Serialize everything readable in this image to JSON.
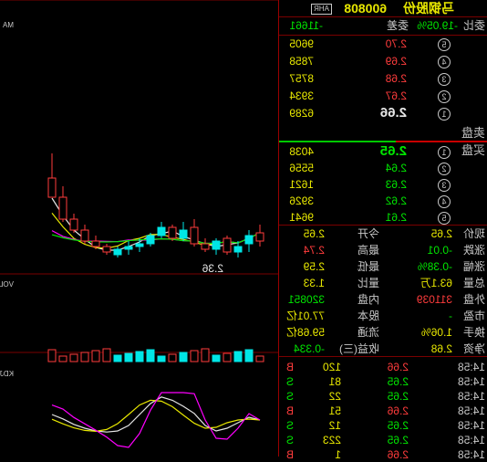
{
  "header": {
    "code": "600808",
    "name": "马钢股份",
    "badge": "AHR"
  },
  "weibi": {
    "label": "委比",
    "pct": "-19.05%",
    "label2": "委差",
    "diff": "-11661"
  },
  "sell_label": "卖盘",
  "buy_label": "买盘",
  "sells": [
    {
      "n": "5",
      "price": "2.70",
      "vol": "9605"
    },
    {
      "n": "4",
      "price": "2.69",
      "vol": "7858"
    },
    {
      "n": "3",
      "price": "2.68",
      "vol": "8757"
    },
    {
      "n": "2",
      "price": "2.67",
      "vol": "3934"
    },
    {
      "n": "1",
      "price": "2.66",
      "vol": "6289"
    }
  ],
  "buys": [
    {
      "n": "1",
      "price": "2.65",
      "vol": "4038"
    },
    {
      "n": "2",
      "price": "2.64",
      "vol": "5556"
    },
    {
      "n": "3",
      "price": "2.63",
      "vol": "1621"
    },
    {
      "n": "4",
      "price": "2.62",
      "vol": "3926"
    },
    {
      "n": "5",
      "price": "2.61",
      "vol": "9641"
    }
  ],
  "stats": [
    {
      "l1": "现价",
      "v1": "2.65",
      "l2": "今开",
      "v2": "2.65"
    },
    {
      "l1": "涨跌",
      "v1": "-0.01",
      "l2": "最高",
      "v2": "2.74"
    },
    {
      "l1": "涨幅",
      "v1": "-0.38%",
      "l2": "最低",
      "v2": "2.59"
    },
    {
      "l1": "总量",
      "v1": "63.1万",
      "l2": "量比",
      "v2": "1.33"
    },
    {
      "l1": "外盘",
      "v1": "311039",
      "l2": "内盘",
      "v2": "320851"
    },
    {
      "l1": "市盈",
      "v1": "-",
      "l2": "股本",
      "v2": "77.01亿"
    },
    {
      "l1": "换手",
      "v1": "1.06%",
      "l2": "流通",
      "v2": "59.68亿"
    },
    {
      "l1": "净资",
      "v1": "2.68",
      "l2": "收益(三)",
      "v2": "-0.334"
    }
  ],
  "ticks": [
    {
      "t": "14:58",
      "p": "2.66",
      "v": "120",
      "s": "B"
    },
    {
      "t": "14:58",
      "p": "2.65",
      "v": "81",
      "s": "S"
    },
    {
      "t": "14:58",
      "p": "2.65",
      "v": "22",
      "s": "S"
    },
    {
      "t": "14:58",
      "p": "2.66",
      "v": "51",
      "s": "B"
    },
    {
      "t": "14:58",
      "p": "2.65",
      "v": "12",
      "s": "S"
    },
    {
      "t": "14:58",
      "p": "2.65",
      "v": "223",
      "s": "S"
    },
    {
      "t": "14:58",
      "p": "2.66",
      "v": "1",
      "s": "B"
    }
  ],
  "chart": {
    "low_label": "2.36",
    "vol_label": "VOL",
    "ind_label": "KDJ",
    "ma_label": "MA"
  },
  "chart_data": {
    "type": "candlestick",
    "low": 2.36,
    "candles": [
      {
        "o": 2.42,
        "c": 2.45,
        "h": 2.48,
        "l": 2.4
      },
      {
        "o": 2.44,
        "c": 2.41,
        "h": 2.46,
        "l": 2.38
      },
      {
        "o": 2.4,
        "c": 2.38,
        "h": 2.42,
        "l": 2.36
      },
      {
        "o": 2.38,
        "c": 2.43,
        "h": 2.44,
        "l": 2.37
      },
      {
        "o": 2.42,
        "c": 2.39,
        "h": 2.43,
        "l": 2.37
      },
      {
        "o": 2.39,
        "c": 2.41,
        "h": 2.43,
        "l": 2.38
      },
      {
        "o": 2.41,
        "c": 2.47,
        "h": 2.5,
        "l": 2.4
      },
      {
        "o": 2.46,
        "c": 2.43,
        "h": 2.49,
        "l": 2.42
      },
      {
        "o": 2.43,
        "c": 2.47,
        "h": 2.48,
        "l": 2.42
      },
      {
        "o": 2.47,
        "c": 2.44,
        "h": 2.49,
        "l": 2.43
      },
      {
        "o": 2.44,
        "c": 2.41,
        "h": 2.45,
        "l": 2.4
      },
      {
        "o": 2.41,
        "c": 2.4,
        "h": 2.43,
        "l": 2.38
      },
      {
        "o": 2.4,
        "c": 2.39,
        "h": 2.42,
        "l": 2.37
      },
      {
        "o": 2.39,
        "c": 2.37,
        "h": 2.4,
        "l": 2.36
      },
      {
        "o": 2.38,
        "c": 2.4,
        "h": 2.41,
        "l": 2.37
      },
      {
        "o": 2.4,
        "c": 2.42,
        "h": 2.44,
        "l": 2.39
      },
      {
        "o": 2.42,
        "c": 2.46,
        "h": 2.48,
        "l": 2.41
      },
      {
        "o": 2.46,
        "c": 2.5,
        "h": 2.52,
        "l": 2.45
      },
      {
        "o": 2.5,
        "c": 2.58,
        "h": 2.62,
        "l": 2.49
      },
      {
        "o": 2.58,
        "c": 2.65,
        "h": 2.74,
        "l": 2.59
      }
    ]
  }
}
